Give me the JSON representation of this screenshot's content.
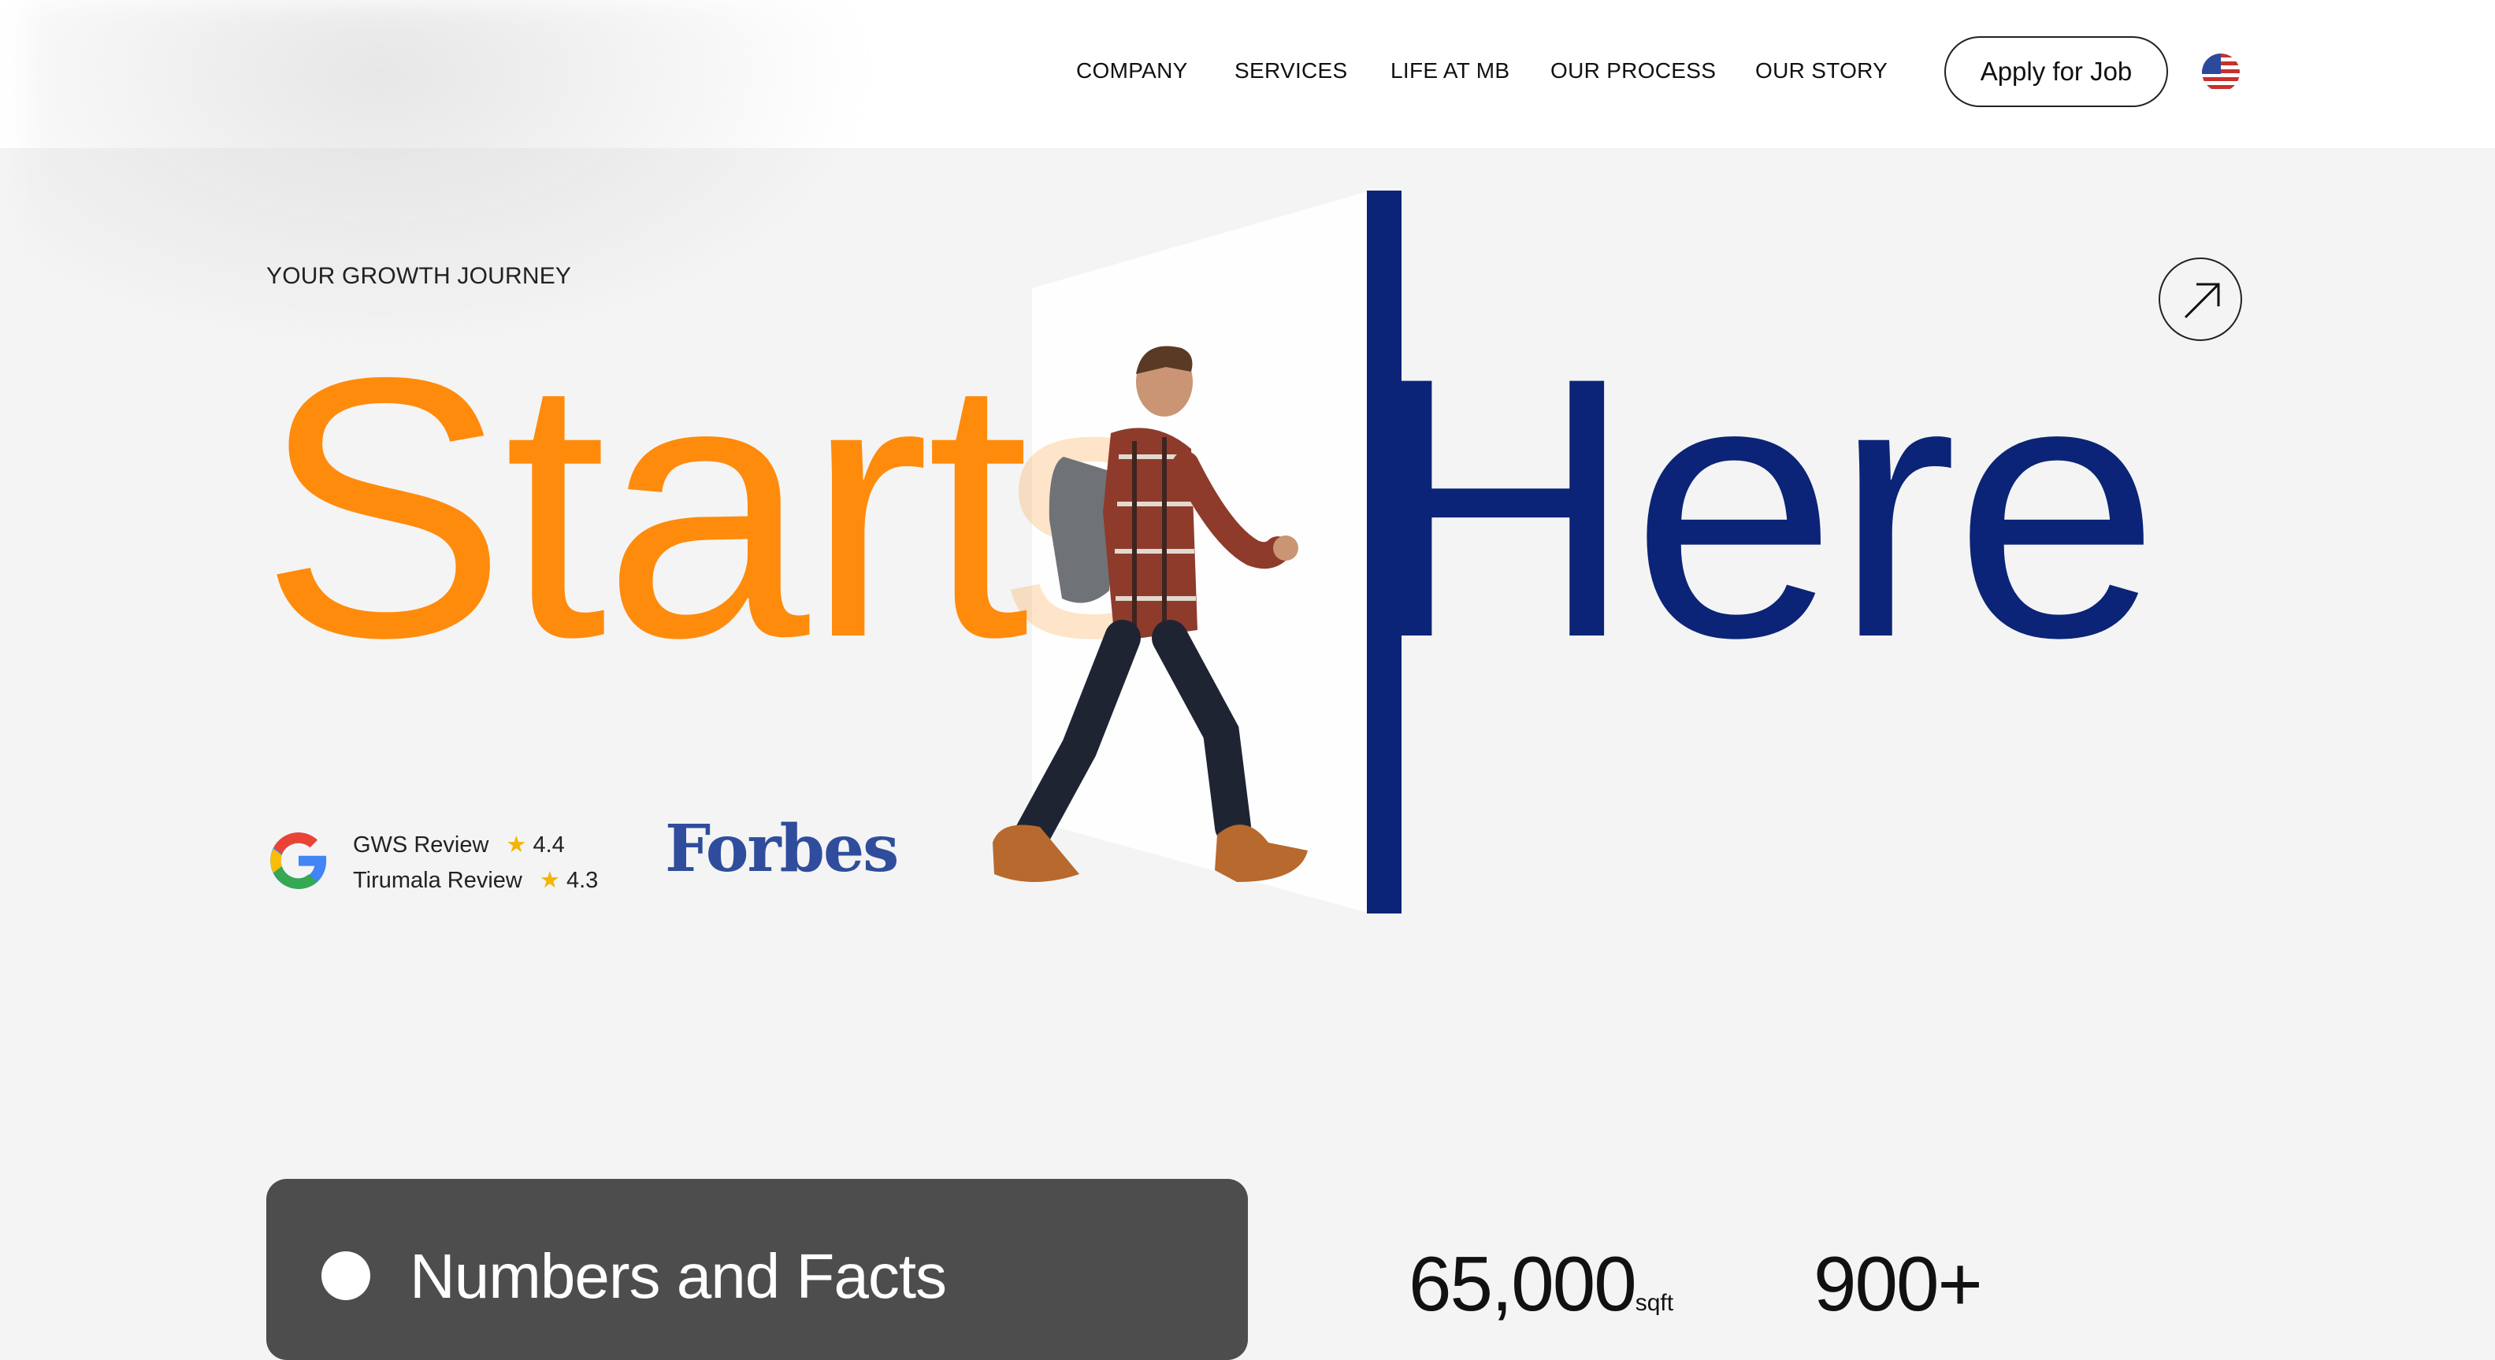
{
  "nav": {
    "items": [
      "COMPANY",
      "SERVICES",
      "LIFE AT MB",
      "OUR PROCESS",
      "OUR STORY"
    ],
    "apply_label": "Apply for Job"
  },
  "hero": {
    "eyebrow": "YOUR GROWTH JOURNEY",
    "word_start": "Start",
    "word_s": "s",
    "word_here": "Here",
    "colors": {
      "orange": "#ff8b0c",
      "navy": "#0b2477"
    }
  },
  "reviews": [
    {
      "label": "GWS Review",
      "rating": "4.4"
    },
    {
      "label": "Tirumala Review",
      "rating": "4.3"
    }
  ],
  "forbes": "Forbes",
  "facts": {
    "title": "Numbers and Facts",
    "stats": [
      {
        "value": "65,000",
        "unit": "sqft"
      },
      {
        "value": "900+",
        "unit": ""
      }
    ]
  }
}
